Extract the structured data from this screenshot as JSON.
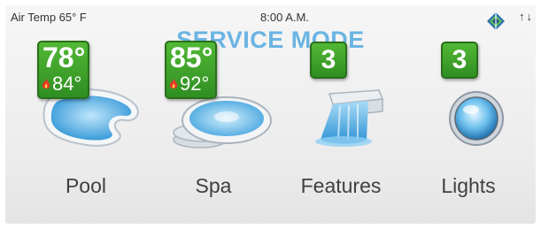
{
  "header": {
    "air_temp": "Air Temp 65° F",
    "time": "8:00 A.M.",
    "status_arrows": "↑↓",
    "mode_title": "SERVICE MODE"
  },
  "tiles": [
    {
      "label": "Pool",
      "current_temp": "78°",
      "set_temp": "84°"
    },
    {
      "label": "Spa",
      "current_temp": "85°",
      "set_temp": "92°"
    },
    {
      "label": "Features",
      "count": "3"
    },
    {
      "label": "Lights",
      "count": "3"
    }
  ],
  "colors": {
    "title": "#6ab4e3",
    "badge": "#3fa32b",
    "flame": "#e8352a",
    "water": "#5fb7e6"
  }
}
